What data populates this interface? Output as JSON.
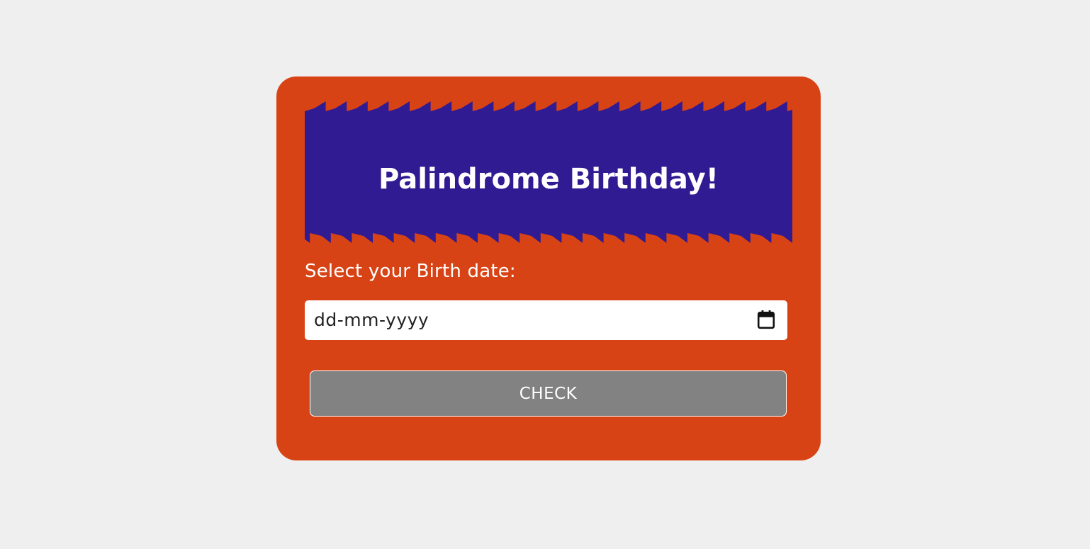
{
  "header": {
    "title": "Palindrome Birthday!"
  },
  "form": {
    "date_label": "Select your Birth date:",
    "date_placeholder": "dd-mm-yyyy",
    "calendar_icon": "calendar-icon",
    "check_label": "CHECK"
  },
  "colors": {
    "page_background": "#efefef",
    "card_background": "#d84315",
    "banner_background": "#311b92",
    "button_background": "#828282",
    "text": "#ffffff"
  }
}
